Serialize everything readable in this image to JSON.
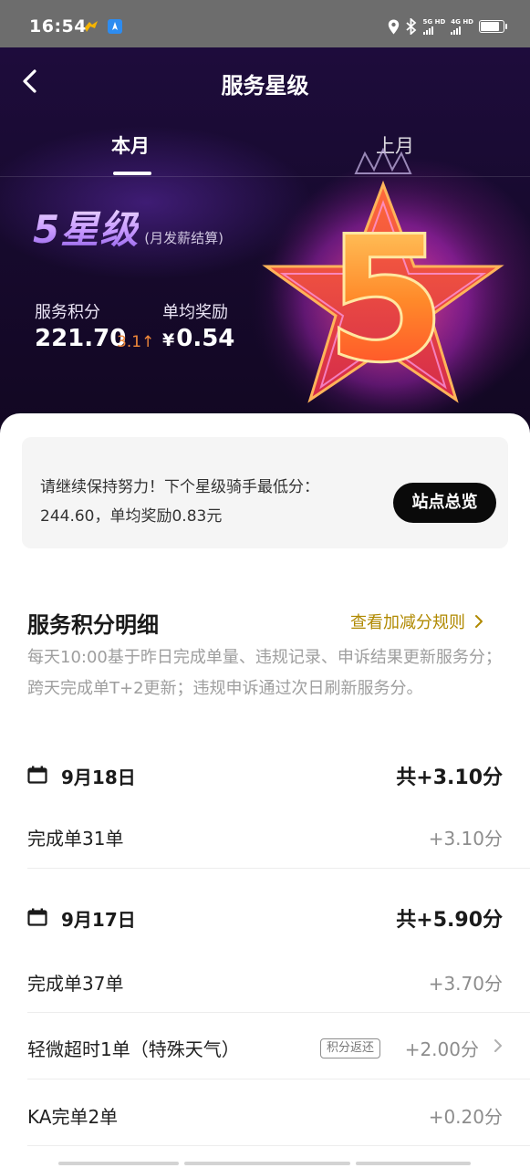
{
  "status_bar": {
    "time": "16:54",
    "signal1": "5G HD",
    "signal2": "4G HD",
    "battery_level": 0.85
  },
  "header": {
    "title": "服务星级",
    "back_icon": "chevron-left-icon"
  },
  "tabs": [
    {
      "label": "本月",
      "active": true
    },
    {
      "label": "上月",
      "active": false
    }
  ],
  "summary": {
    "star_level": "5星级",
    "star_level_note": "(月发薪结算)",
    "score_label": "服务积分",
    "score_value": "221.70",
    "score_delta": "3.1↑",
    "reward_label": "单均奖励",
    "reward_currency": "¥",
    "reward_value": "0.54",
    "medal_number": "5"
  },
  "notice": {
    "text": "请继续保持努力！下个星级骑手最低分：244.60，单均奖励0.83元",
    "button": "站点总览"
  },
  "details": {
    "title": "服务积分明细",
    "rules_link": "查看加减分规则",
    "description": "每天10:00基于昨日完成单量、违规记录、申诉结果更新服务分；跨天完成单T+2更新；违规申诉通过次日刷新服务分。",
    "days": [
      {
        "date": "9月18日",
        "total": "共+3.10分",
        "rows": [
          {
            "label": "完成单31单",
            "value": "+3.10分"
          }
        ]
      },
      {
        "date": "9月17日",
        "total": "共+5.90分",
        "rows": [
          {
            "label": "完成单37单",
            "value": "+3.70分"
          },
          {
            "label": "轻微超时1单（特殊天气）",
            "badge": "积分返还",
            "value": "+2.00分"
          },
          {
            "label": "KA完单2单",
            "value": "+0.20分"
          }
        ]
      }
    ]
  },
  "colors": {
    "accent_gold": "#b08900",
    "delta_orange": "#f0883a",
    "hero_bg": "#1e0c3c"
  }
}
